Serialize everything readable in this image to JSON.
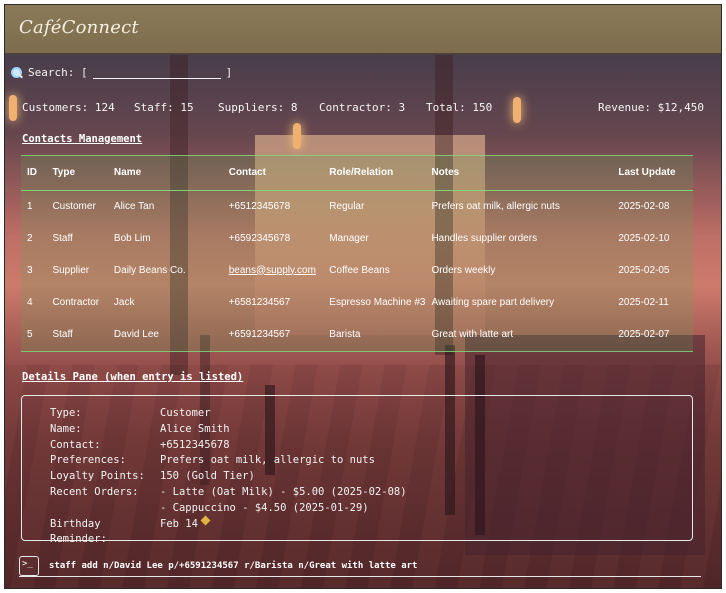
{
  "app": {
    "title": "CaféConnect"
  },
  "search": {
    "label": "Search: [",
    "value": "",
    "close": "]"
  },
  "stats": {
    "customers": "Customers: 124",
    "staff": "Staff: 15",
    "suppliers": "Suppliers: 8",
    "contractor": "Contractor: 3",
    "total": "Total: 150",
    "revenue": "Revenue: $12,450"
  },
  "contacts": {
    "heading": "Contacts Management",
    "columns": [
      "ID",
      "Type",
      "Name",
      "Contact",
      "Role/Relation",
      "Notes",
      "Last Update"
    ],
    "rows": [
      {
        "id": "1",
        "type": "Customer",
        "name": "Alice Tan",
        "contact": "+6512345678",
        "role": "Regular",
        "notes": "Prefers oat milk, allergic nuts",
        "updated": "2025-02-08"
      },
      {
        "id": "2",
        "type": "Staff",
        "name": "Bob Lim",
        "contact": "+6592345678",
        "role": "Manager",
        "notes": "Handles supplier orders",
        "updated": "2025-02-10"
      },
      {
        "id": "3",
        "type": "Supplier",
        "name": "Daily Beans Co.",
        "contact": "beans@supply.com",
        "role": "Coffee Beans",
        "notes": "Orders weekly",
        "updated": "2025-02-05"
      },
      {
        "id": "4",
        "type": "Contractor",
        "name": "Jack",
        "contact": "+6581234567",
        "role": "Espresso Machine #3",
        "notes": "Awaiting spare part delivery",
        "updated": "2025-02-11"
      },
      {
        "id": "5",
        "type": "Staff",
        "name": "David Lee",
        "contact": "+6591234567",
        "role": "Barista",
        "notes": "Great with latte art",
        "updated": "2025-02-07"
      }
    ]
  },
  "details": {
    "heading": "Details Pane (when entry is listed)",
    "fields": [
      {
        "label": "Type:",
        "value": "Customer"
      },
      {
        "label": "Name:",
        "value": "Alice Smith"
      },
      {
        "label": "Contact:",
        "value": "+6512345678"
      },
      {
        "label": "Preferences:",
        "value": "Prefers oat milk, allergic to nuts"
      },
      {
        "label": "Loyalty Points:",
        "value": "150 (Gold Tier)"
      },
      {
        "label": "Recent Orders:",
        "value": "- Latte (Oat Milk) - $5.00 (2025-02-08)"
      },
      {
        "label": "",
        "value": "- Cappuccino - $4.50 (2025-01-29)"
      },
      {
        "label": "Birthday Reminder:",
        "value": "Feb 14"
      }
    ]
  },
  "command": {
    "text": "staff add n/David Lee p/+6591234567 r/Barista n/Great with latte art"
  },
  "colors": {
    "titlebar": "#7d6d4e",
    "table_highlight": "#5aaa5a",
    "text": "#ffffff"
  },
  "icons": {
    "search": "search-icon",
    "terminal": "terminal-icon",
    "birthday": "pin-icon"
  }
}
